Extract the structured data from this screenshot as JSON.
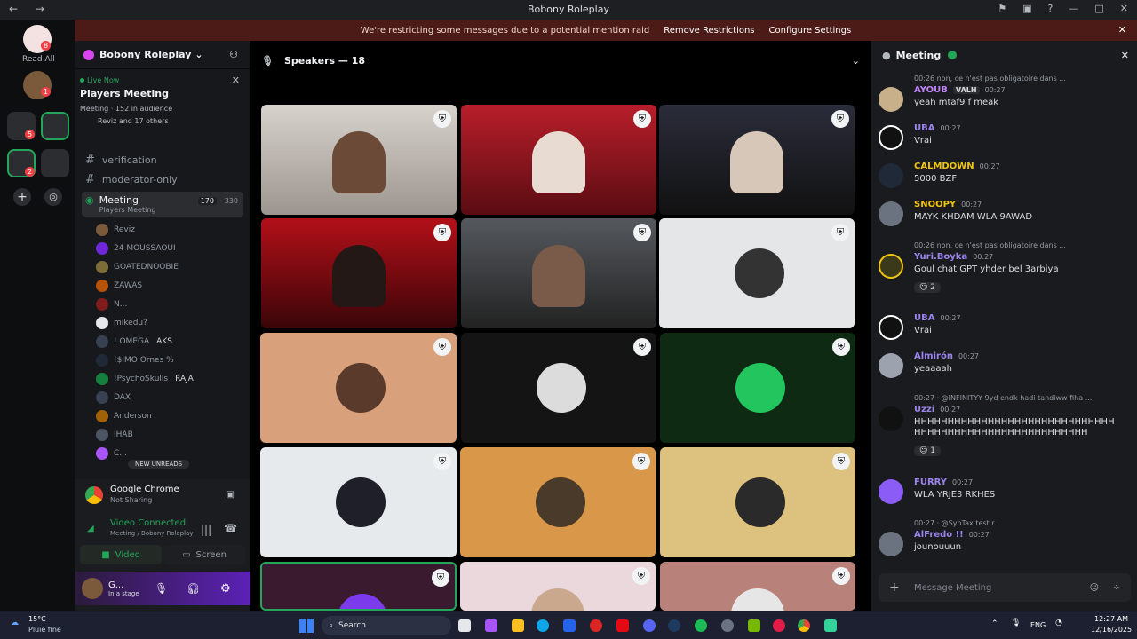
{
  "window": {
    "title": "Bobony Roleplay",
    "nav": "← →"
  },
  "banner": {
    "message": "We're restricting some messages due to a potential mention raid",
    "remove_label": "Remove Restrictions",
    "configure_label": "Configure Settings"
  },
  "rail": {
    "read_all": "Read All",
    "badges": [
      "8",
      "1",
      "5",
      "2"
    ]
  },
  "guild": {
    "name": "Bobony Roleplay"
  },
  "stage": {
    "live": "Live Now",
    "title": "Players Meeting",
    "meta": "Meeting · 152 in audience",
    "audience": "Reviz and 17 others"
  },
  "channels": [
    {
      "prefix": "#",
      "name": "verification"
    },
    {
      "prefix": "#",
      "name": "moderator-only"
    }
  ],
  "voice_channel": {
    "name": "Meeting",
    "subtitle": "Players Meeting",
    "count": "170",
    "total": "330"
  },
  "members": [
    "Reviz",
    "24 MOUSSAOUI",
    "GOATEDNOOBIE",
    "ZAWAS",
    "N...",
    "mikedu?",
    "! OMEGA",
    "!$IMO Ornes %",
    "!PsychoSkulls",
    "DAX",
    "Anderson",
    "IHAB",
    "C..."
  ],
  "member_tags": {
    "omega": "AKS",
    "psycho": "RAJA"
  },
  "new_unreads": "NEW UNREADS",
  "voice_panel": {
    "app": "Google Chrome",
    "app_status": "Not Sharing",
    "connected": "Video Connected",
    "location": "Meeting / Bobony Roleplay",
    "video_label": "Video",
    "screen_label": "Screen",
    "user": "G...",
    "user_status": "In a stage"
  },
  "speakers": {
    "label": "Speakers — 18"
  },
  "chat": {
    "title": "Meeting",
    "input_placeholder": "Message Meeting",
    "messages": [
      {
        "reply": "00:26 non, ce n'est pas obligatoire dans ...",
        "name": "AYOUB",
        "time": "00:27",
        "text": "yeah mtaf9 f meak",
        "color": "#c084fc",
        "tag": "VALH"
      },
      {
        "name": "UBA",
        "time": "00:27",
        "text": "Vrai",
        "color": "#9b84ec"
      },
      {
        "name": "CALMDOWN",
        "time": "00:27",
        "text": "5000 BZF",
        "color": "#f1c40f"
      },
      {
        "name": "SNOOPY",
        "time": "00:27",
        "text": "MAYK KHDAM WLA 9AWAD",
        "color": "#f1c40f"
      },
      {
        "reply": "00:26 non, ce n'est pas obligatoire dans ...",
        "name": "Yuri.Boyka",
        "time": "00:27",
        "text": "Goul chat GPT yhder bel 3arbiya",
        "color": "#9b84ec",
        "react": "2"
      },
      {
        "name": "UBA",
        "time": "00:27",
        "text": "Vrai",
        "color": "#9b84ec"
      },
      {
        "name": "Almirón",
        "time": "00:27",
        "text": "yeaaaah",
        "color": "#9b84ec"
      },
      {
        "reply": "00:27 · @INFINITYY 9yd endk hadi tandiww fiha ...",
        "name": "Uzzi",
        "time": "00:27",
        "text": "HHHHHHHHHHHHHHHHHHHHHHHHHHHHHHHHHHHHHHHHHHHHHHHHHHHHHHHH",
        "color": "#9b84ec",
        "react": "1"
      },
      {
        "name": "FURRY",
        "time": "00:27",
        "text": "WLA YRJE3 RKHES",
        "color": "#9b84ec"
      },
      {
        "reply": "00:27 · @SynTax test r.",
        "name": "AlFredo !!",
        "time": "00:27",
        "text": "jounouuun",
        "color": "#9b84ec"
      }
    ]
  },
  "taskbar": {
    "weather_temp": "15°C",
    "weather_desc": "Pluie fine",
    "search": "Search",
    "lang": "ENG",
    "time": "12:27 AM",
    "date": "12/16/2025"
  },
  "colors": {
    "accent": "#5865f2",
    "live": "#23a55a",
    "banner": "#4c1b17"
  }
}
